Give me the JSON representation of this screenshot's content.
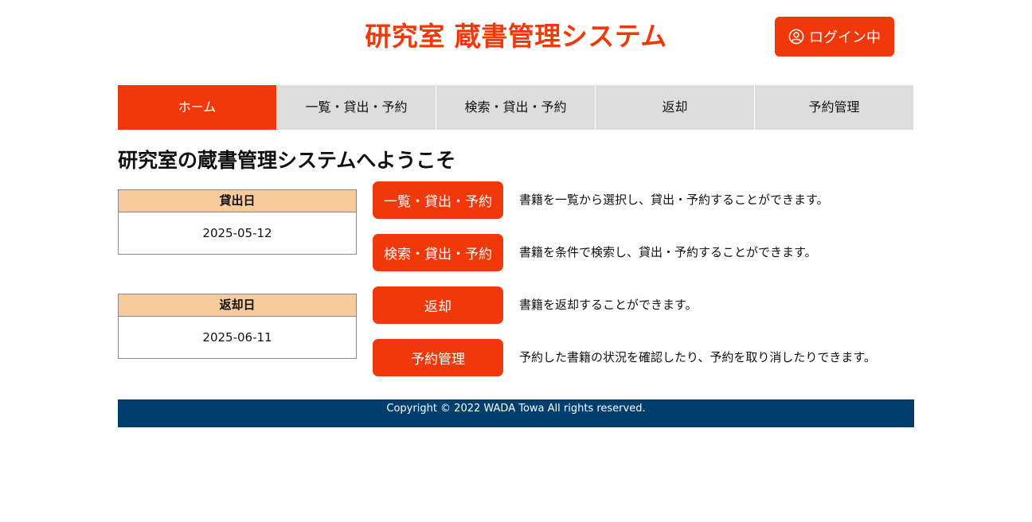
{
  "header": {
    "title": "研究室 蔵書管理システム",
    "login_label": "ログイン中",
    "login_icon": "user-circle-icon"
  },
  "nav": {
    "items": [
      {
        "label": "ホーム",
        "active": true
      },
      {
        "label": "一覧・貸出・予約",
        "active": false
      },
      {
        "label": "検索・貸出・予約",
        "active": false
      },
      {
        "label": "返却",
        "active": false
      },
      {
        "label": "予約管理",
        "active": false
      }
    ]
  },
  "main": {
    "welcome": "研究室の蔵書管理システムへようこそ",
    "dates": [
      {
        "label": "貸出日",
        "value": "2025-05-12"
      },
      {
        "label": "返却日",
        "value": "2025-06-11"
      }
    ],
    "features": [
      {
        "button": "一覧・貸出・予約",
        "description": "書籍を一覧から選択し、貸出・予約することができます。"
      },
      {
        "button": "検索・貸出・予約",
        "description": "書籍を条件で検索し、貸出・予約することができます。"
      },
      {
        "button": "返却",
        "description": "書籍を返却することができます。"
      },
      {
        "button": "予約管理",
        "description": "予約した書籍の状況を確認したり、予約を取り消したりできます。"
      }
    ]
  },
  "footer": {
    "copyright": "Copyright © 2022 WADA Towa All rights reserved."
  },
  "colors": {
    "accent": "#f0380a",
    "nav_bg": "#dddddd",
    "date_header_bg": "#f8cb9c",
    "footer_bg": "#003f6d"
  }
}
